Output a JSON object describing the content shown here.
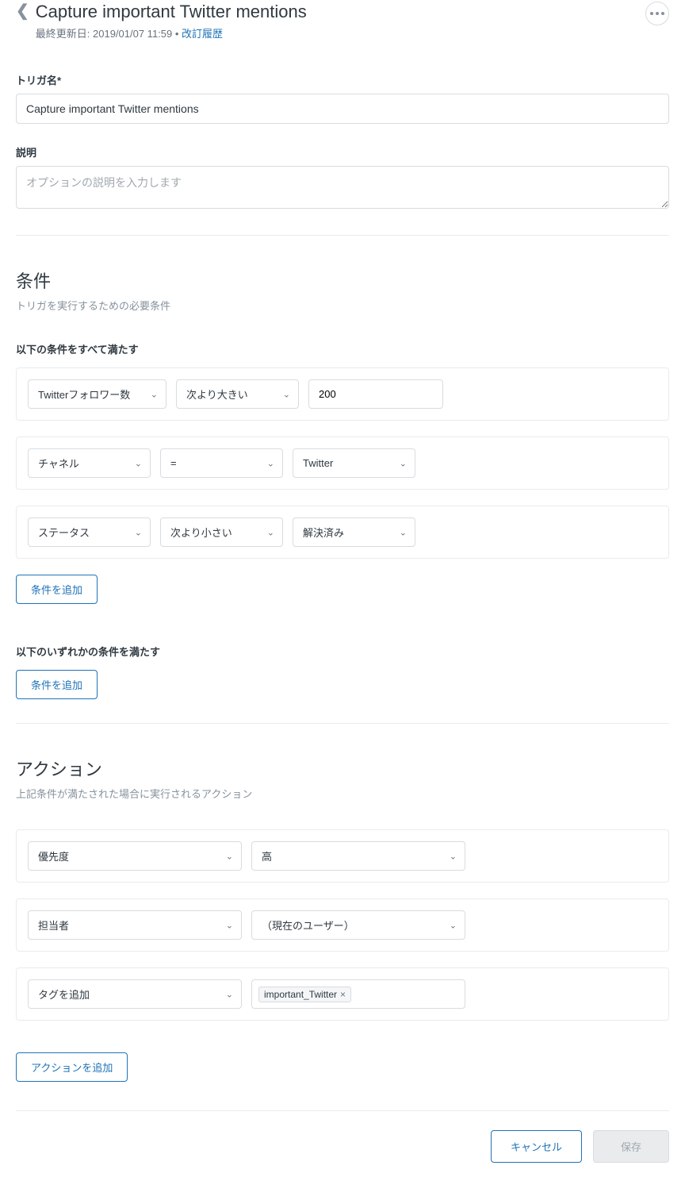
{
  "header": {
    "title": "Capture important Twitter mentions",
    "last_updated_prefix": "最終更新日: ",
    "last_updated_value": "2019/01/07 11:59",
    "separator": " • ",
    "revision_link": "改訂履歴"
  },
  "trigger_name": {
    "label": "トリガ名*",
    "value": "Capture important Twitter mentions"
  },
  "description": {
    "label": "説明",
    "placeholder": "オプションの説明を入力します"
  },
  "conditions": {
    "title": "条件",
    "description": "トリガを実行するための必要条件",
    "all_label": "以下の条件をすべて満たす",
    "any_label": "以下のいずれかの条件を満たす",
    "add_button": "条件を追加",
    "rows": [
      {
        "field": "Twitterフォロワー数",
        "operator": "次より大きい",
        "value": "200",
        "value_type": "input"
      },
      {
        "field": "チャネル",
        "operator": "=",
        "value": "Twitter",
        "value_type": "select"
      },
      {
        "field": "ステータス",
        "operator": "次より小さい",
        "value": "解決済み",
        "value_type": "select"
      }
    ]
  },
  "actions": {
    "title": "アクション",
    "description": "上記条件が満たされた場合に実行されるアクション",
    "add_button": "アクションを追加",
    "rows": [
      {
        "field": "優先度",
        "value": "高",
        "type": "select"
      },
      {
        "field": "担当者",
        "value": "（現在のユーザー）",
        "type": "select"
      },
      {
        "field": "タグを追加",
        "value": "important_Twitter",
        "type": "tag"
      }
    ]
  },
  "footer": {
    "cancel": "キャンセル",
    "save": "保存"
  }
}
